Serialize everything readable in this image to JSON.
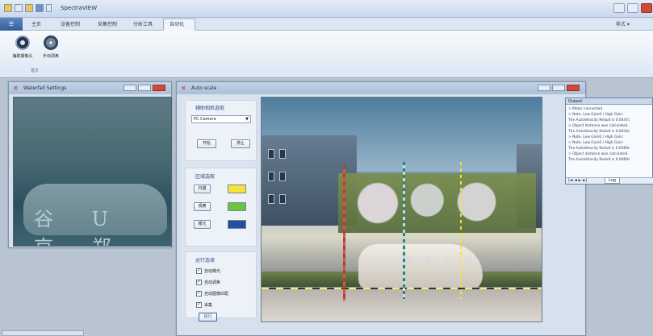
{
  "app": {
    "title": "SpectraVIEW",
    "style_label": "样式 ▾"
  },
  "ribbon": {
    "tabs": [
      {
        "label": "主页"
      },
      {
        "label": "设备控制"
      },
      {
        "label": "采集控制"
      },
      {
        "label": "分析工具"
      },
      {
        "label": "自动化",
        "active": true
      }
    ],
    "tools": [
      {
        "label": "辅助摄像头",
        "icon": "camera-icon"
      },
      {
        "label": "手动调焦",
        "icon": "focus-icon"
      }
    ],
    "group_label": "基本"
  },
  "waterfall": {
    "title": "Waterfall Settings",
    "rock_text": "谷 U 京 郑"
  },
  "auto_scale": {
    "title": "Auto scale",
    "camera_section": {
      "title": "辅助相机选取",
      "selected": "PC Camera",
      "start_label": "开始",
      "stop_label": "停止"
    },
    "region_section": {
      "title": "区域选取",
      "items": [
        {
          "label": "扫描",
          "color": "#f4e33b"
        },
        {
          "label": "观察",
          "color": "#6ec33c"
        },
        {
          "label": "曝光",
          "color": "#234f9d"
        }
      ]
    },
    "run_section": {
      "title": "运行选择",
      "checks": [
        {
          "label": "自动曝光"
        },
        {
          "label": "自动调焦"
        },
        {
          "label": "自动图像匹配"
        },
        {
          "label": "采集"
        }
      ],
      "run_label": "执行"
    },
    "scene": {
      "stone_text": "航 済 U 谷"
    }
  },
  "output": {
    "title": "Output",
    "lines": [
      "> Motor connected",
      "> Note. Low Gain0  /  High Gain:",
      "The AutoVelocity Redult is 0.0447c",
      "> Object distance was calculated.",
      "The AutoVelocity Redult is 0.0034c",
      "> Note. Low Gain0  /  High Gain:",
      "> Note. Low Gain0  /  High Gain:",
      "The AutoVelocity Redult is 0.0069c",
      "> Object distance was calculated.",
      "The AutoVelocity Redult is 0.0069c"
    ],
    "nav_label": "|◄  ◄  ►  ►|",
    "log_tab": "Log"
  },
  "colors": {
    "ribbon_blue": "#355f9b",
    "close_red": "#cf4b38",
    "yellow": "#f4e33b",
    "green": "#6ec33c",
    "blue": "#234f9d"
  }
}
